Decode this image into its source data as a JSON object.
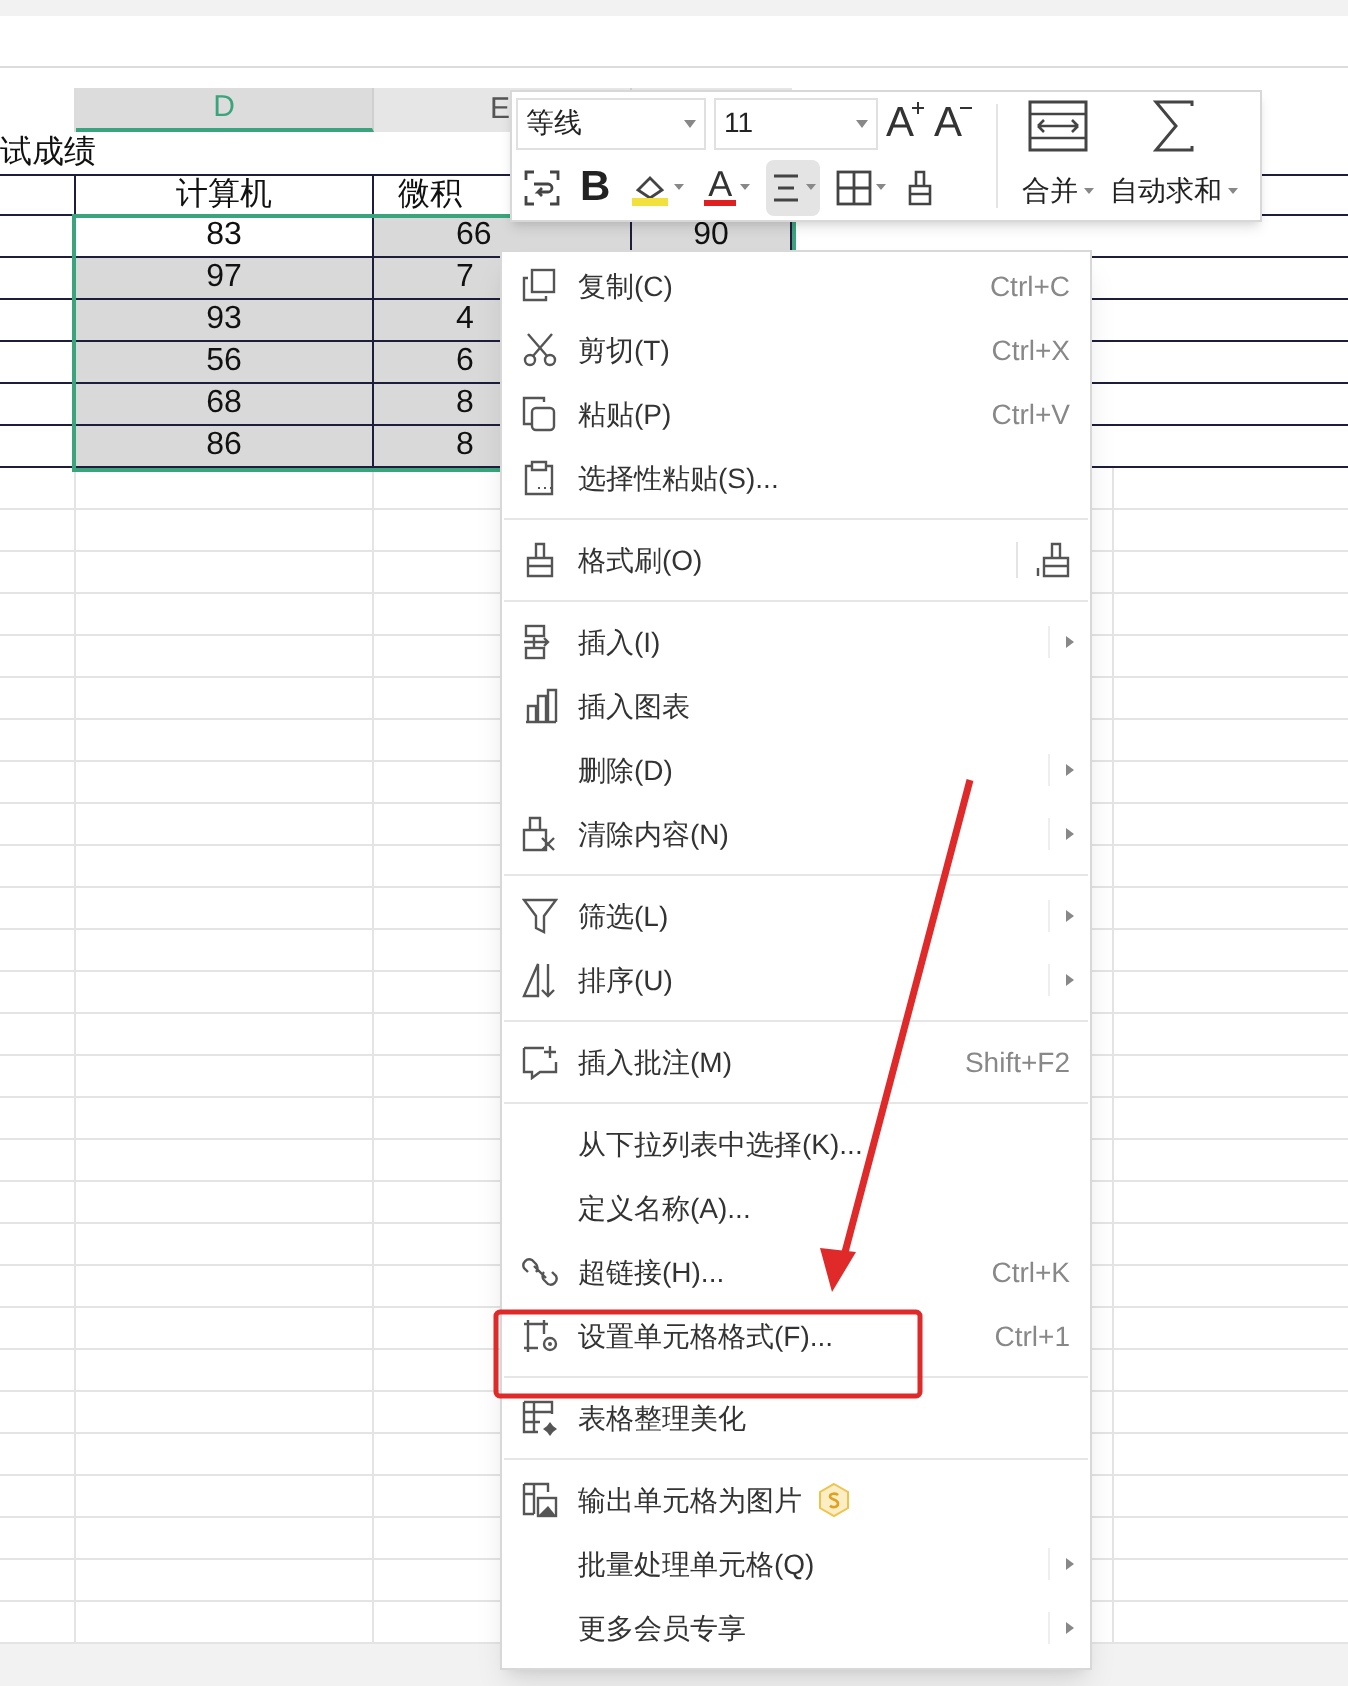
{
  "sheet": {
    "columns": [
      {
        "label": "D",
        "selected": true
      },
      {
        "label": "E",
        "selected": false
      }
    ],
    "title_cell": "试成绩",
    "header_cells": [
      "计算机",
      "微积"
    ],
    "rows": [
      {
        "cells": [
          {
            "text": "83",
            "active": true
          },
          {
            "text": "66",
            "active": false
          },
          {
            "text": "90",
            "active": false
          }
        ]
      },
      {
        "cells": [
          {
            "text": "97",
            "active": false
          },
          {
            "text": "7",
            "active": false
          }
        ]
      },
      {
        "cells": [
          {
            "text": "93",
            "active": false
          },
          {
            "text": "4",
            "active": false
          }
        ]
      },
      {
        "cells": [
          {
            "text": "56",
            "active": false
          },
          {
            "text": "6",
            "active": false
          }
        ]
      },
      {
        "cells": [
          {
            "text": "68",
            "active": false
          },
          {
            "text": "8",
            "active": false
          }
        ]
      },
      {
        "cells": [
          {
            "text": "86",
            "active": false
          },
          {
            "text": "8",
            "active": false
          }
        ]
      }
    ]
  },
  "toolbar": {
    "font": "等线",
    "size": "11",
    "size_tools": [
      {
        "label": "A",
        "kind": "grow"
      },
      {
        "label": "A",
        "kind": "shrink"
      }
    ],
    "format_tools": [
      {
        "kind": "wrap",
        "selected": false
      },
      {
        "kind": "bold",
        "label": "B",
        "selected": false
      },
      {
        "kind": "fill",
        "color": "#f2e03c",
        "selected": false
      },
      {
        "kind": "font-color",
        "label": "A",
        "color": "#e02020",
        "selected": false
      },
      {
        "kind": "align",
        "selected": true
      },
      {
        "kind": "border",
        "selected": false
      },
      {
        "kind": "painter",
        "selected": false
      }
    ],
    "big_buttons": [
      {
        "kind": "merge",
        "label": "合并"
      },
      {
        "kind": "sum",
        "label": "自动求和"
      }
    ]
  },
  "context_menu": {
    "items": [
      {
        "kind": "item",
        "label": "复制(C)",
        "shortcut": "Ctrl+C"
      },
      {
        "kind": "item",
        "label": "剪切(T)",
        "shortcut": "Ctrl+X"
      },
      {
        "kind": "item",
        "label": "粘贴(P)",
        "shortcut": "Ctrl+V"
      },
      {
        "kind": "item",
        "label": "选择性粘贴(S)..."
      },
      {
        "kind": "separator"
      },
      {
        "kind": "item",
        "label": "格式刷(O)",
        "trailing_icon": true
      },
      {
        "kind": "separator"
      },
      {
        "kind": "item",
        "label": "插入(I)",
        "submenu": true
      },
      {
        "kind": "item",
        "label": "插入图表"
      },
      {
        "kind": "item",
        "label": "删除(D)",
        "submenu": true
      },
      {
        "kind": "item",
        "label": "清除内容(N)",
        "submenu": true
      },
      {
        "kind": "separator"
      },
      {
        "kind": "item",
        "label": "筛选(L)",
        "submenu": true
      },
      {
        "kind": "item",
        "label": "排序(U)",
        "submenu": true
      },
      {
        "kind": "separator"
      },
      {
        "kind": "item",
        "label": "插入批注(M)",
        "shortcut": "Shift+F2"
      },
      {
        "kind": "separator"
      },
      {
        "kind": "item",
        "label": "从下拉列表中选择(K)..."
      },
      {
        "kind": "item",
        "label": "定义名称(A)..."
      },
      {
        "kind": "item",
        "label": "超链接(H)...",
        "shortcut": "Ctrl+K"
      },
      {
        "kind": "item",
        "label": "设置单元格格式(F)...",
        "shortcut": "Ctrl+1"
      },
      {
        "kind": "separator"
      },
      {
        "kind": "item",
        "label": "表格整理美化"
      },
      {
        "kind": "separator"
      },
      {
        "kind": "item",
        "label": "输出单元格为图片",
        "vip": true
      },
      {
        "kind": "item",
        "label": "批量处理单元格(Q)",
        "submenu": true
      },
      {
        "kind": "item",
        "label": "更多会员专享",
        "submenu": true
      }
    ]
  },
  "annotation": {
    "kind": "arrow-and-frame"
  }
}
